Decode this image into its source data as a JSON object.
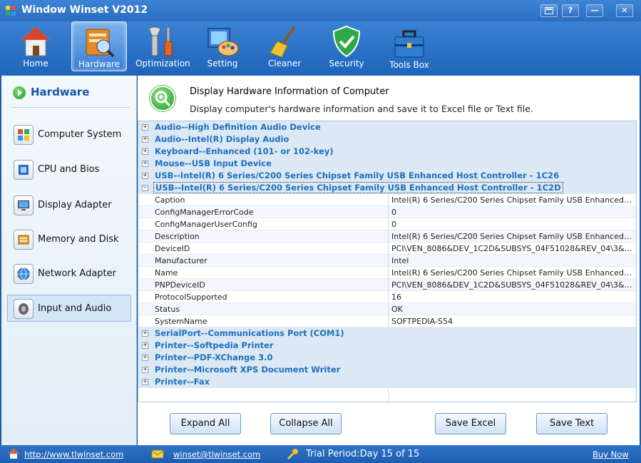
{
  "window": {
    "title": "Window Winset V2012"
  },
  "toolbar": [
    {
      "label": "Home",
      "icon": "house-icon"
    },
    {
      "label": "Hardware",
      "icon": "hardware-icon"
    },
    {
      "label": "Optimization",
      "icon": "tools-icon"
    },
    {
      "label": "Setting",
      "icon": "palette-icon"
    },
    {
      "label": "Cleaner",
      "icon": "broom-icon"
    },
    {
      "label": "Security",
      "icon": "shield-icon"
    },
    {
      "label": "Tools Box",
      "icon": "toolbox-icon"
    }
  ],
  "sidebar": {
    "heading": "Hardware",
    "items": [
      {
        "label": "Computer System",
        "icon": "windows-icon"
      },
      {
        "label": "CPU and Bios",
        "icon": "chip-icon"
      },
      {
        "label": "Display Adapter",
        "icon": "monitor-icon"
      },
      {
        "label": "Memory and Disk",
        "icon": "memory-icon"
      },
      {
        "label": "Network Adapter",
        "icon": "globe-icon"
      },
      {
        "label": "Input and Audio",
        "icon": "speaker-icon"
      }
    ]
  },
  "banner": {
    "title": "Display  Hardware Information of Computer",
    "description": "Display computer's hardware information and save it to Excel file or Text file."
  },
  "devices_top": [
    "Audio--High Definition Audio Device",
    "Audio--Intel(R) Display Audio",
    "Keyboard--Enhanced (101- or 102-key)",
    "Mouse--USB Input Device",
    "USB--Intel(R) 6 Series/C200 Series Chipset Family USB Enhanced Host Controller - 1C26"
  ],
  "expanded_device": {
    "name": "USB--Intel(R) 6 Series/C200 Series Chipset Family USB Enhanced Host Controller - 1C2D",
    "properties": [
      {
        "key": "Caption",
        "value": "Intel(R) 6 Series/C200 Series Chipset Family USB Enhanced Host Co..."
      },
      {
        "key": "ConfigManagerErrorCode",
        "value": "0"
      },
      {
        "key": "ConfigManagerUserConfig",
        "value": "0"
      },
      {
        "key": "Description",
        "value": "Intel(R) 6 Series/C200 Series Chipset Family USB Enhanced Host Co..."
      },
      {
        "key": "DeviceID",
        "value": "PCI\\VEN_8086&DEV_1C2D&SUBSYS_04F51028&REV_04\\3&1158..."
      },
      {
        "key": "Manufacturer",
        "value": "Intel"
      },
      {
        "key": "Name",
        "value": "Intel(R) 6 Series/C200 Series Chipset Family USB Enhanced Host Co..."
      },
      {
        "key": "PNPDeviceID",
        "value": "PCI\\VEN_8086&DEV_1C2D&SUBSYS_04F51028&REV_04\\3&1158..."
      },
      {
        "key": "ProtocolSupported",
        "value": "16"
      },
      {
        "key": "Status",
        "value": "OK"
      },
      {
        "key": "SystemName",
        "value": "SOFTPEDIA-S54"
      }
    ]
  },
  "devices_bottom": [
    "SerialPort--Communications Port (COM1)",
    "Printer--Softpedia Printer",
    "Printer--PDF-XChange 3.0",
    "Printer--Microsoft XPS Document Writer",
    "Printer--Fax"
  ],
  "tree_symbols": {
    "collapsed": "+",
    "expanded": "−"
  },
  "buttons": {
    "expand_all": "Expand All",
    "collapse_all": "Collapse All",
    "save_excel": "Save Excel",
    "save_text": "Save Text"
  },
  "status": {
    "website": "http://www.tlwinset.com",
    "email": "winset@tlwinset.com",
    "trial": "Trial Period:Day 15 of 15",
    "buy": "Buy Now"
  },
  "colors": {
    "accent": "#2a6cc0",
    "device_text": "#1d6fbf",
    "device_row": "#dce9f5"
  }
}
